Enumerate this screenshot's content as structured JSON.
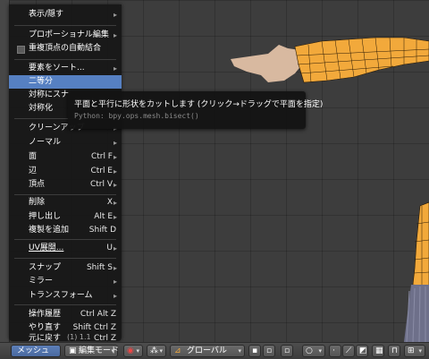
{
  "menu": {
    "items": [
      {
        "label": "表示/隠す",
        "arrow": true
      },
      {
        "label": "プロポーショナル編集",
        "arrow": true
      },
      {
        "label": "重複頂点の自動結合",
        "checkbox": true
      },
      {
        "label": "要素をソート...",
        "arrow": true
      },
      {
        "label": "二等分",
        "highlight": true
      },
      {
        "label": "対称にスナ"
      },
      {
        "label": "対称化"
      },
      {
        "label": "クリーンアップ",
        "arrow": true
      },
      {
        "label": "ノーマル",
        "arrow": true
      },
      {
        "label": "面",
        "shortcut": "Ctrl F",
        "arrow": true
      },
      {
        "label": "辺",
        "shortcut": "Ctrl E",
        "arrow": true
      },
      {
        "label": "頂点",
        "shortcut": "Ctrl V",
        "arrow": true
      },
      {
        "label": "削除",
        "shortcut": "X",
        "arrow": true
      },
      {
        "label": "押し出し",
        "shortcut": "Alt E",
        "arrow": true
      },
      {
        "label": "複製を追加",
        "shortcut": "Shift D"
      },
      {
        "label": "UV展開...",
        "shortcut": "U",
        "arrow": true
      },
      {
        "label": "スナップ",
        "shortcut": "Shift S",
        "arrow": true
      },
      {
        "label": "ミラー",
        "arrow": true
      },
      {
        "label": "トランスフォーム",
        "arrow": true
      },
      {
        "label": "操作履歴",
        "shortcut": "Ctrl Alt Z"
      },
      {
        "label": "やり直す",
        "shortcut": "Shift Ctrl Z"
      },
      {
        "label": "元に戻す",
        "shortcut": "Ctrl Z"
      }
    ]
  },
  "tooltip": {
    "description": "平面と平行に形状をカットします (クリック→ドラッグで平面を指定)",
    "python": "Python: bpy.ops.mesh.bisect()"
  },
  "header": {
    "menu_label": "メッシュ",
    "mode": "編集モード",
    "pivot": "グローバル",
    "frame": "(1) 1.1"
  },
  "colors": {
    "highlight": "#5680c2",
    "mesh_orange": "#f2a93b",
    "header": "#474747"
  },
  "icons": [
    "chevron-right-icon",
    "checkbox-icon",
    "viewport-shading-icon",
    "pivot-icon",
    "manipulator-icon",
    "vertex-select-icon",
    "edge-select-icon",
    "face-select-icon",
    "snap-icon",
    "occlude-icon"
  ]
}
